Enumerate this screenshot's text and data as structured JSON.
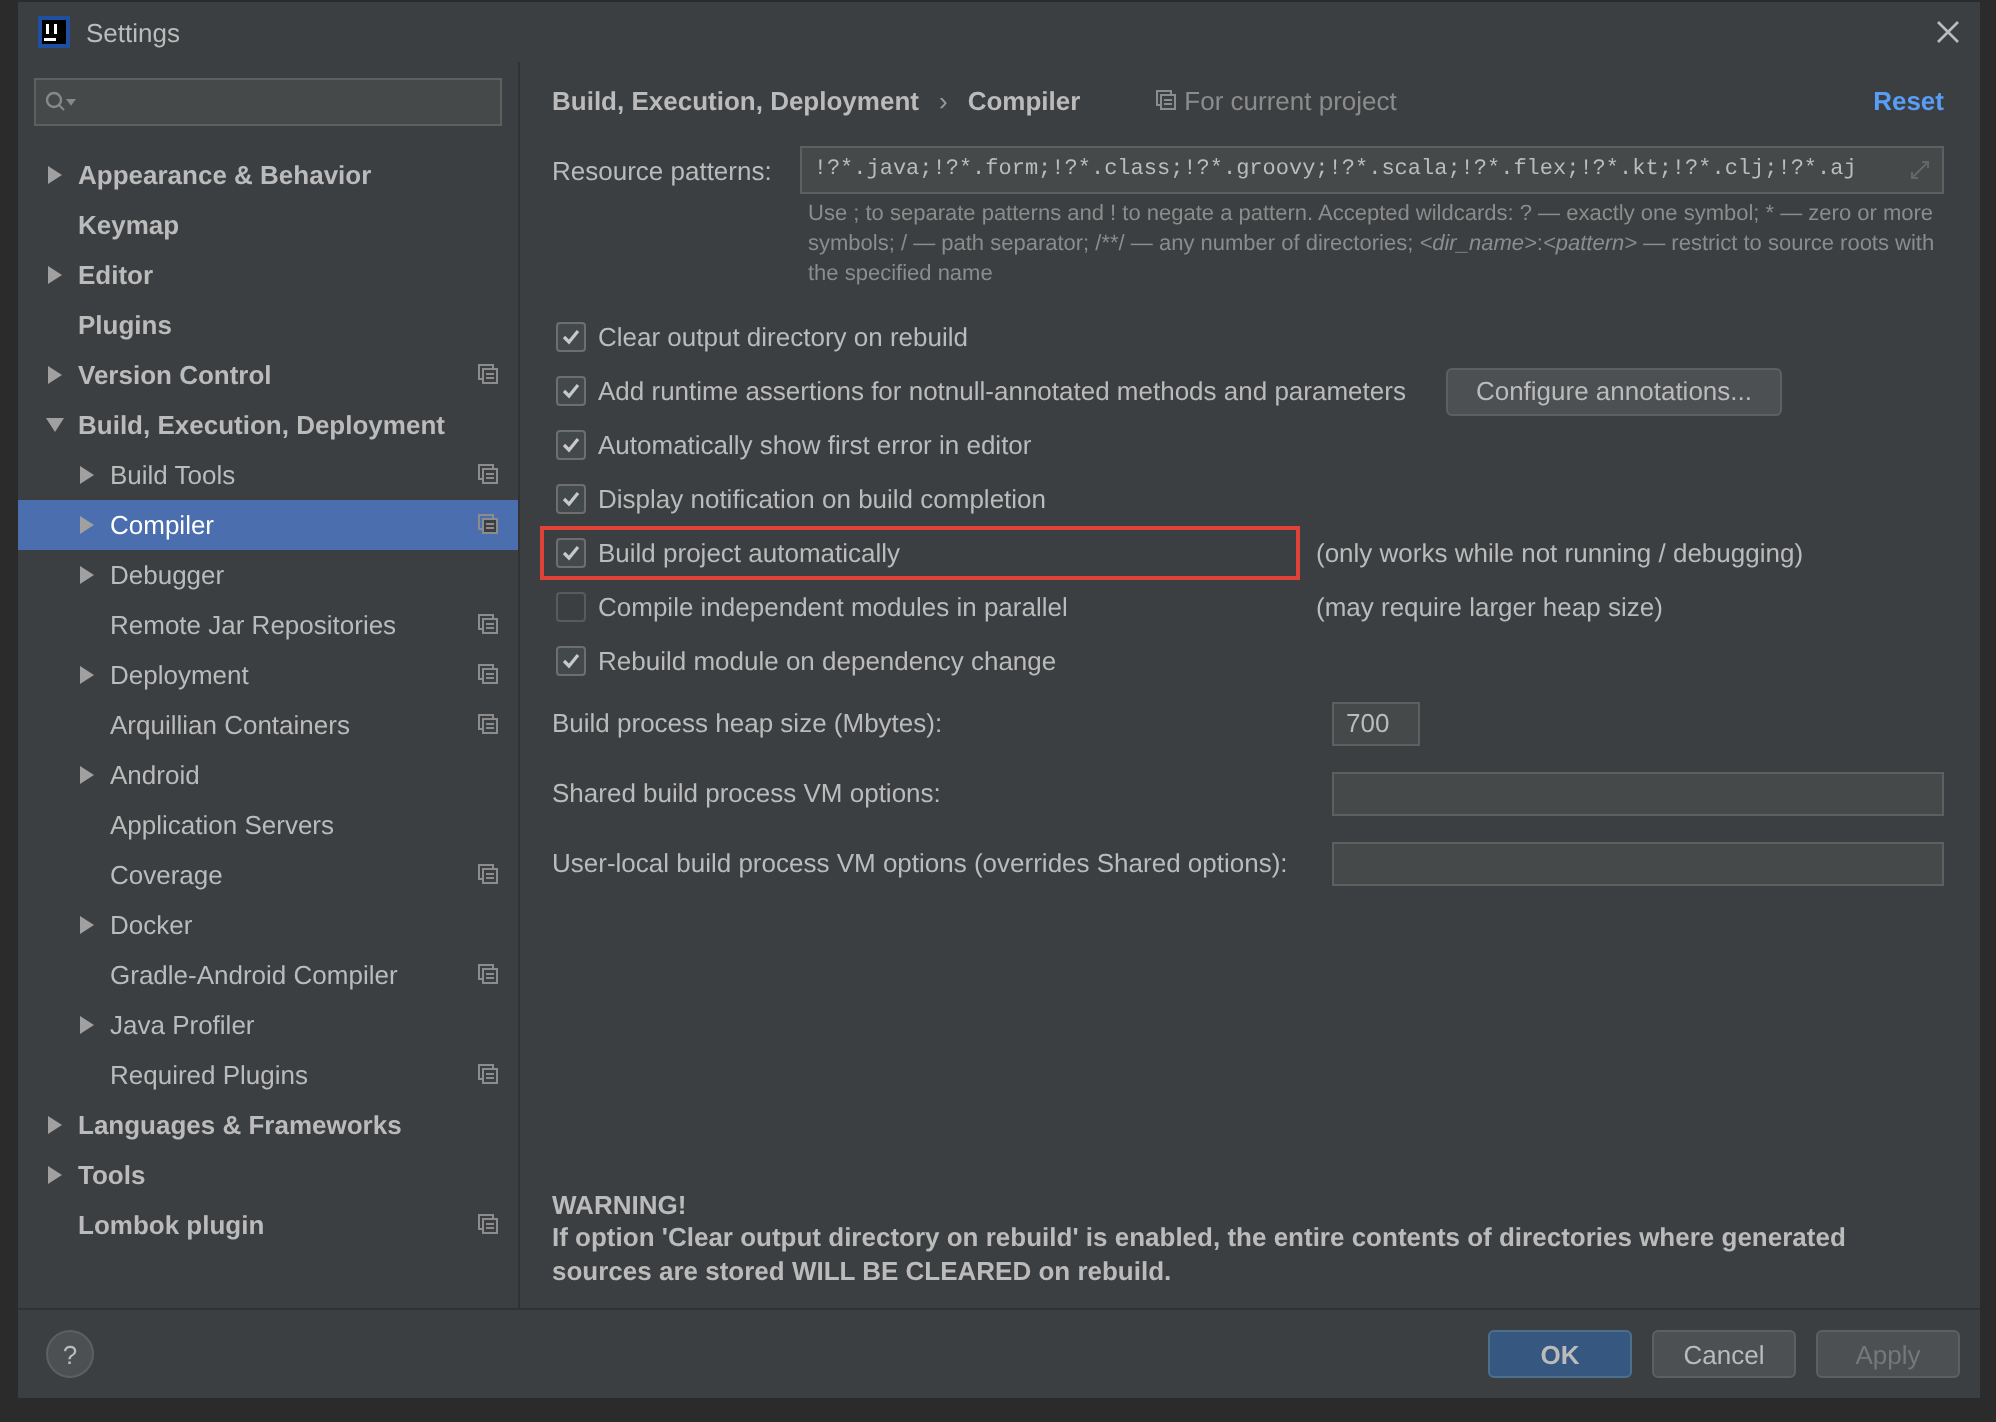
{
  "window": {
    "title": "Settings"
  },
  "sidebar": {
    "items": [
      {
        "label": "Appearance & Behavior",
        "kind": "folder",
        "expanded": false,
        "selected": false,
        "project_level": false
      },
      {
        "label": "Keymap",
        "kind": "page",
        "selected": false,
        "project_level": false
      },
      {
        "label": "Editor",
        "kind": "folder",
        "expanded": false,
        "selected": false,
        "project_level": false
      },
      {
        "label": "Plugins",
        "kind": "page",
        "selected": false,
        "project_level": false
      },
      {
        "label": "Version Control",
        "kind": "folder",
        "expanded": false,
        "selected": false,
        "project_level": true
      },
      {
        "label": "Build, Execution, Deployment",
        "kind": "folder",
        "expanded": true,
        "selected": false,
        "project_level": false,
        "children": [
          {
            "label": "Build Tools",
            "kind": "folder",
            "expanded": false,
            "selected": false,
            "project_level": true
          },
          {
            "label": "Compiler",
            "kind": "folder",
            "expanded": false,
            "selected": true,
            "project_level": true
          },
          {
            "label": "Debugger",
            "kind": "folder",
            "expanded": false,
            "selected": false,
            "project_level": false
          },
          {
            "label": "Remote Jar Repositories",
            "kind": "page",
            "selected": false,
            "project_level": true
          },
          {
            "label": "Deployment",
            "kind": "folder",
            "expanded": false,
            "selected": false,
            "project_level": true
          },
          {
            "label": "Arquillian Containers",
            "kind": "page",
            "selected": false,
            "project_level": true
          },
          {
            "label": "Android",
            "kind": "folder",
            "expanded": false,
            "selected": false,
            "project_level": false
          },
          {
            "label": "Application Servers",
            "kind": "page",
            "selected": false,
            "project_level": false
          },
          {
            "label": "Coverage",
            "kind": "page",
            "selected": false,
            "project_level": true
          },
          {
            "label": "Docker",
            "kind": "folder",
            "expanded": false,
            "selected": false,
            "project_level": false
          },
          {
            "label": "Gradle-Android Compiler",
            "kind": "page",
            "selected": false,
            "project_level": true
          },
          {
            "label": "Java Profiler",
            "kind": "folder",
            "expanded": false,
            "selected": false,
            "project_level": false
          },
          {
            "label": "Required Plugins",
            "kind": "page",
            "selected": false,
            "project_level": true
          }
        ]
      },
      {
        "label": "Languages & Frameworks",
        "kind": "folder",
        "expanded": false,
        "selected": false,
        "project_level": false
      },
      {
        "label": "Tools",
        "kind": "folder",
        "expanded": false,
        "selected": false,
        "project_level": false
      },
      {
        "label": "Lombok plugin",
        "kind": "page",
        "selected": false,
        "project_level": true
      }
    ]
  },
  "header": {
    "breadcrumb": [
      "Build, Execution, Deployment",
      "Compiler"
    ],
    "separator": "›",
    "scope": "For current project",
    "reset": "Reset"
  },
  "resource_patterns": {
    "label": "Resource patterns:",
    "value": "!?*.java;!?*.form;!?*.class;!?*.groovy;!?*.scala;!?*.flex;!?*.kt;!?*.clj;!?*.aj",
    "hint": "Use ; to separate patterns and ! to negate a pattern. Accepted wildcards: ? — exactly one symbol; * — zero or more symbols; / — path separator; /**/ — any number of directories; *<dir_name>*:*<pattern>* — restrict to source roots with the specified name"
  },
  "options": [
    {
      "label": "Clear output directory on rebuild",
      "checked": true,
      "highlighted": false
    },
    {
      "label": "Add runtime assertions for notnull-annotated methods and parameters",
      "checked": true,
      "highlighted": false,
      "button": "Configure annotations..."
    },
    {
      "label": "Automatically show first error in editor",
      "checked": true,
      "highlighted": false
    },
    {
      "label": "Display notification on build completion",
      "checked": true,
      "highlighted": false
    },
    {
      "label": "Build project automatically",
      "checked": true,
      "highlighted": true,
      "note": "(only works while not running / debugging)"
    },
    {
      "label": "Compile independent modules in parallel",
      "checked": false,
      "highlighted": false,
      "note": "(may require larger heap size)"
    },
    {
      "label": "Rebuild module on dependency change",
      "checked": true,
      "highlighted": false
    }
  ],
  "fields": [
    {
      "label": "Build process heap size (Mbytes):",
      "value": "700",
      "kind": "short"
    },
    {
      "label": "Shared build process VM options:",
      "kind": "wide"
    },
    {
      "label": "User-local build process VM options (overrides Shared options):",
      "kind": "wide"
    }
  ],
  "warning": {
    "title": "WARNING!",
    "text": "If option 'Clear output directory on rebuild' is enabled, the entire contents of directories where generated sources are stored WILL BE CLEARED on rebuild."
  },
  "footer": {
    "help": "?",
    "buttons": [
      {
        "label": "OK",
        "kind": "primary",
        "disabled": false
      },
      {
        "label": "Cancel",
        "kind": "normal",
        "disabled": false
      },
      {
        "label": "Apply",
        "kind": "normal",
        "disabled": true
      }
    ]
  }
}
